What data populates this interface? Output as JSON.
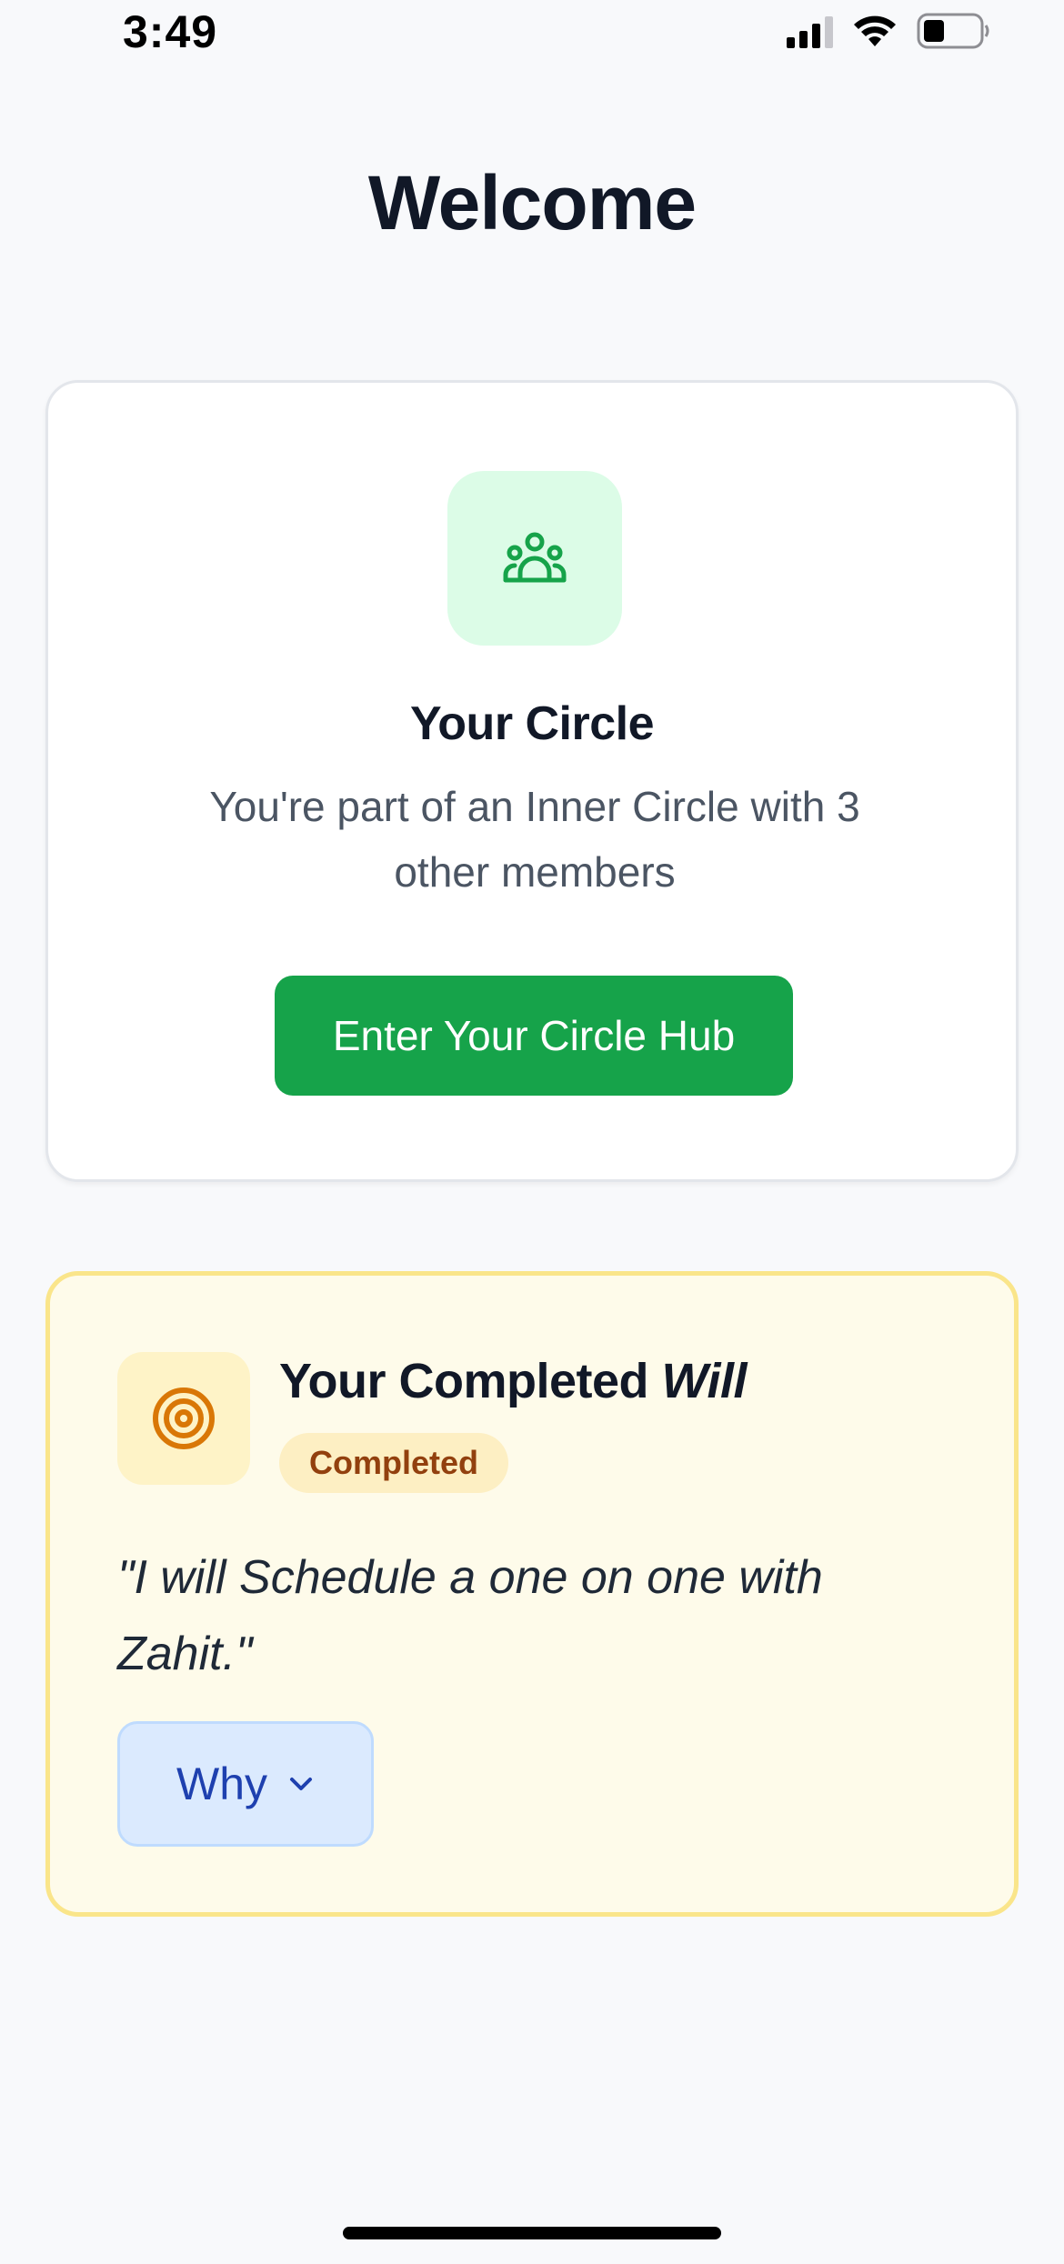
{
  "status_bar": {
    "time": "3:49",
    "icons": [
      "signal-icon",
      "wifi-icon",
      "battery-icon"
    ]
  },
  "page": {
    "title": "Welcome"
  },
  "circle_card": {
    "icon": "people-group-icon",
    "title": "Your Circle",
    "description": "You're part of an Inner Circle with 3 other members",
    "button_label": "Enter Your Circle Hub"
  },
  "will_card": {
    "icon": "target-icon",
    "title_prefix": "Your Completed ",
    "title_emphasis": "Will",
    "status_badge": "Completed",
    "quote": "\"I will Schedule a one on one with Zahit.\"",
    "why_button_label": "Why"
  },
  "colors": {
    "accent_green": "#16a34a",
    "icon_green_bg": "#dcfce7",
    "will_card_bg": "#fefbea",
    "will_card_border": "#fae58a",
    "target_orange": "#d97706",
    "why_blue": "#1e40af"
  }
}
